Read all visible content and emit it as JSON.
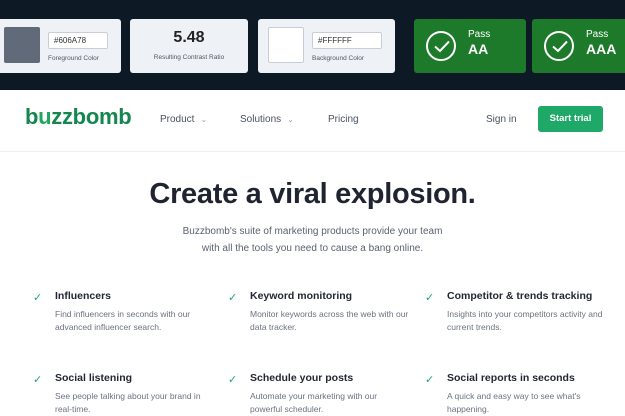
{
  "contrast_checker": {
    "foreground": {
      "hex": "#606A78",
      "caption": "Foreground Color",
      "swatch_color": "#606a78"
    },
    "ratio": {
      "value": "5.48",
      "caption": "Resulting Contrast Ratio"
    },
    "background": {
      "hex": "#FFFFFF",
      "caption": "Background Color",
      "swatch_color": "#ffffff"
    },
    "results": [
      {
        "label": "Pass",
        "level": "AA",
        "icon": "check-circle-icon"
      },
      {
        "label": "Pass",
        "level": "AAA",
        "icon": "check-circle-icon"
      }
    ],
    "pass_color": "#1d7a2a",
    "bar_color": "#0d1a26"
  },
  "nav": {
    "logo": {
      "part1": "b",
      "part2": "u",
      "part3": "zzbomb"
    },
    "links": [
      {
        "label": "Product",
        "dropdown": true
      },
      {
        "label": "Solutions",
        "dropdown": true
      },
      {
        "label": "Pricing",
        "dropdown": false
      }
    ],
    "sign_in": "Sign in",
    "cta": "Start trial",
    "brand_color": "#1ea968"
  },
  "hero": {
    "title": "Create a viral explosion.",
    "subtitle_line1": "Buzzbomb's suite of marketing products provide your team",
    "subtitle_line2": "with all the tools you need to cause a bang online."
  },
  "features": [
    {
      "title": "Influencers",
      "desc": "Find influencers in seconds with our advanced influencer search."
    },
    {
      "title": "Keyword monitoring",
      "desc": "Monitor keywords across the web with our data tracker."
    },
    {
      "title": "Competitor & trends tracking",
      "desc": "Insights into your competitors activity and current trends."
    },
    {
      "title": "Social listening",
      "desc": "See people talking about your brand in real-time."
    },
    {
      "title": "Schedule your posts",
      "desc": "Automate your marketing with our powerful scheduler."
    },
    {
      "title": "Social reports in seconds",
      "desc": "A quick and easy way to see what's happening."
    }
  ]
}
